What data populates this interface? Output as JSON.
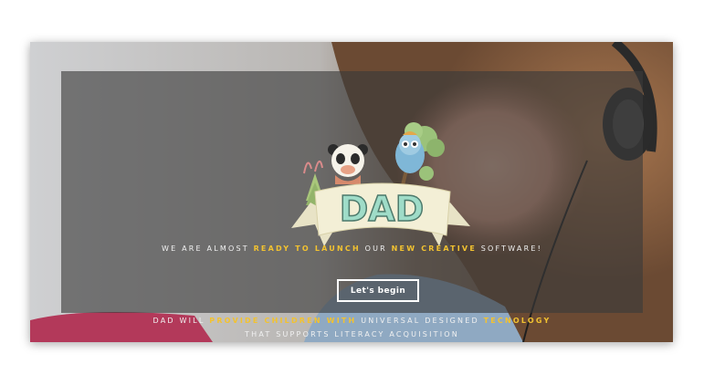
{
  "hero": {
    "logo_text": "DAD",
    "tagline": {
      "part1": "WE ARE ALMOST ",
      "hl1": "READY TO LAUNCH",
      "part2": " OUR ",
      "hl2": "NEW CREATIVE",
      "part3": " SOFTWARE!"
    },
    "cta_label": "Let's begin",
    "mission": {
      "part1": "DAD WILL ",
      "hl1": "PROVIDE CHILDREN WITH",
      "part2": " UNIVERSAL DESIGNED ",
      "hl2": "TECNOLOGY",
      "line2": "THAT SUPPORTS LITERACY ACQUISITION"
    }
  },
  "colors": {
    "highlight": "#f2c230",
    "overlay": "rgba(58,58,58,0.62)",
    "logo_fill": "#9fdcc8",
    "ribbon": "#f3efd6"
  },
  "icons": [
    "panda-icon",
    "owl-icon",
    "tree-icon",
    "headphones-icon"
  ]
}
